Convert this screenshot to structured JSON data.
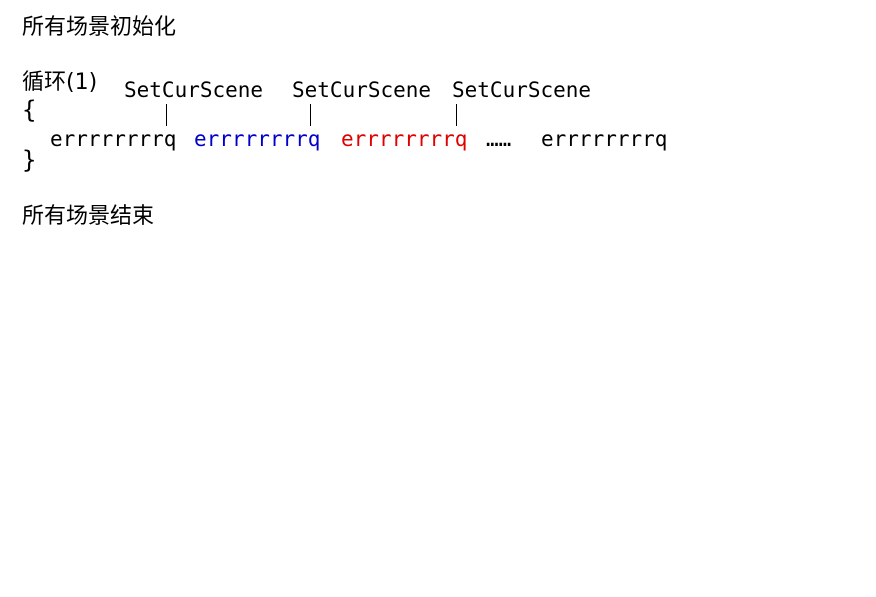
{
  "diagram": {
    "init_label": "所有场景初始化",
    "loop_label": "循环(1)",
    "open_brace": "{",
    "close_brace": "}",
    "end_label": "所有场景结束",
    "scene_markers": [
      {
        "label": "SetCurScene"
      },
      {
        "label": "SetCurScene"
      },
      {
        "label": "SetCurScene"
      }
    ],
    "segments": [
      {
        "text": "errrrrrrrq",
        "color": "#000000"
      },
      {
        "text": "errrrrrrrq",
        "color": "#0000cc"
      },
      {
        "text": "errrrrrrrq",
        "color": "#e00000"
      },
      {
        "text": "……",
        "color": "#000000"
      },
      {
        "text": "errrrrrrrq",
        "color": "#000000"
      }
    ]
  }
}
